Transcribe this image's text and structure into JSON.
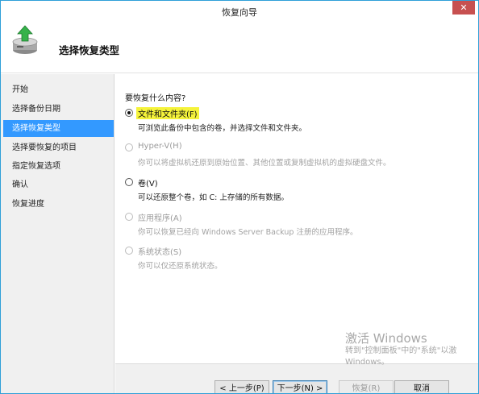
{
  "window": {
    "title": "恢复向导",
    "close_glyph": "✕"
  },
  "header": {
    "title": "选择恢复类型",
    "icon": "backup-recovery-icon"
  },
  "sidebar": {
    "items": [
      {
        "label": "开始",
        "active": false
      },
      {
        "label": "选择备份日期",
        "active": false
      },
      {
        "label": "选择恢复类型",
        "active": true
      },
      {
        "label": "选择要恢复的项目",
        "active": false
      },
      {
        "label": "指定恢复选项",
        "active": false
      },
      {
        "label": "确认",
        "active": false
      },
      {
        "label": "恢复进度",
        "active": false
      }
    ]
  },
  "main": {
    "question": "要恢复什么内容?",
    "options": [
      {
        "label": "文件和文件夹(F)",
        "description": "可浏览此备份中包含的卷，并选择文件和文件夹。",
        "selected": true,
        "enabled": true
      },
      {
        "label": "Hyper-V(H)",
        "description": "你可以将虚拟机还原到原始位置、其他位置或复制虚拟机的虚拟硬盘文件。",
        "selected": false,
        "enabled": false
      },
      {
        "label": "卷(V)",
        "description": "可以还原整个卷，如 C: 上存储的所有数据。",
        "selected": false,
        "enabled": true
      },
      {
        "label": "应用程序(A)",
        "description": "你可以恢复已经向 Windows Server Backup 注册的应用程序。",
        "selected": false,
        "enabled": false
      },
      {
        "label": "系统状态(S)",
        "description": "你可以仅还原系统状态。",
        "selected": false,
        "enabled": false
      }
    ]
  },
  "watermark": {
    "title": "激活 Windows",
    "line1": "转到\"控制面板\"中的\"系统\"以激",
    "line2": "Windows。"
  },
  "footer": {
    "prev_label": "< 上一步(P)",
    "next_label": "下一步(N) >",
    "recover_label": "恢复(R)",
    "cancel_label": "取消"
  },
  "colors": {
    "accent": "#3399ff",
    "highlight": "#f5f33a",
    "close_button": "#c75050"
  }
}
